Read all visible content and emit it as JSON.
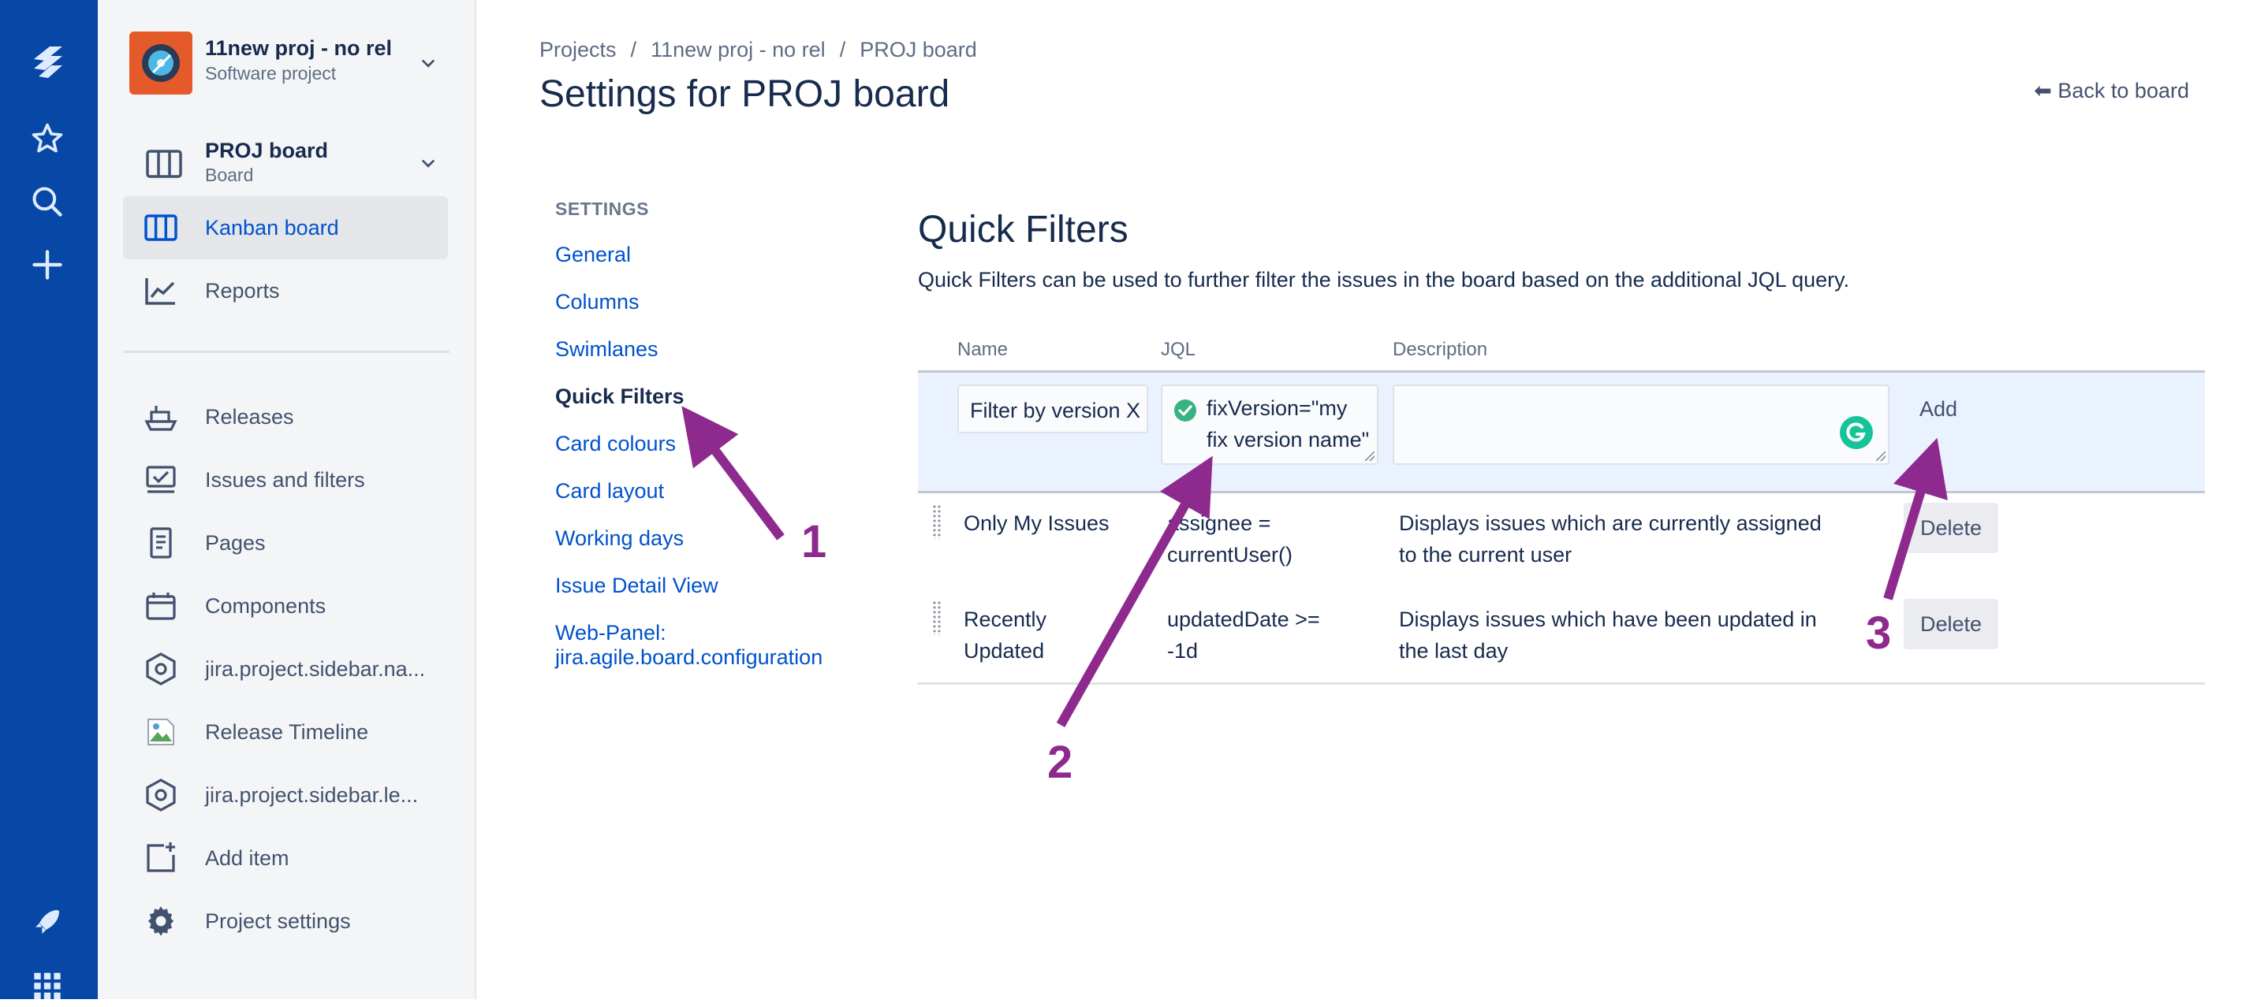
{
  "project": {
    "name": "11new proj - no rel",
    "type": "Software project"
  },
  "board": {
    "name": "PROJ board",
    "sub": "Board"
  },
  "sidebar": {
    "active_item": "Kanban board",
    "reports": "Reports",
    "items": [
      "Releases",
      "Issues and filters",
      "Pages",
      "Components",
      "jira.project.sidebar.na...",
      "Release Timeline",
      "jira.project.sidebar.le...",
      "Add item",
      "Project settings"
    ]
  },
  "breadcrumb": [
    "Projects",
    "11new proj - no rel",
    "PROJ board"
  ],
  "page_title": "Settings for PROJ board",
  "back_link": "Back to board",
  "settings_nav": {
    "heading": "SETTINGS",
    "items": [
      "General",
      "Columns",
      "Swimlanes",
      "Quick Filters",
      "Card colours",
      "Card layout",
      "Working days",
      "Issue Detail View",
      "Web-Panel:",
      "jira.agile.board.configuration"
    ]
  },
  "quick_filters": {
    "title": "Quick Filters",
    "description": "Quick Filters can be used to further filter the issues in the board based on the additional JQL query.",
    "columns": [
      "Name",
      "JQL",
      "Description"
    ],
    "new_filter": {
      "name_value": "Filter by version X",
      "jql_line1": "fixVersion=\"my",
      "jql_line2": "fix version name\"",
      "description_value": "",
      "add_label": "Add"
    },
    "rows": [
      {
        "name_line1": "Only My Issues",
        "name_line2": "",
        "jql_line1": "assignee =",
        "jql_line2": "currentUser()",
        "desc_line1": "Displays issues which are currently assigned",
        "desc_line2": "to the current user",
        "delete_label": "Delete"
      },
      {
        "name_line1": "Recently",
        "name_line2": "Updated",
        "jql_line1": "updatedDate >=",
        "jql_line2": "-1d",
        "desc_line1": "Displays issues which have been updated in",
        "desc_line2": "the last day",
        "delete_label": "Delete"
      }
    ]
  },
  "annotations": [
    "1",
    "2",
    "3"
  ],
  "colors": {
    "rail": "#0747a6",
    "link": "#0052cc",
    "annotation": "#8e2a8e",
    "sidebar_bg": "#f4f5f7"
  },
  "icons": [
    "jira-logo-icon",
    "star-icon",
    "search-icon",
    "plus-icon",
    "rocket-icon",
    "app-grid-icon"
  ]
}
